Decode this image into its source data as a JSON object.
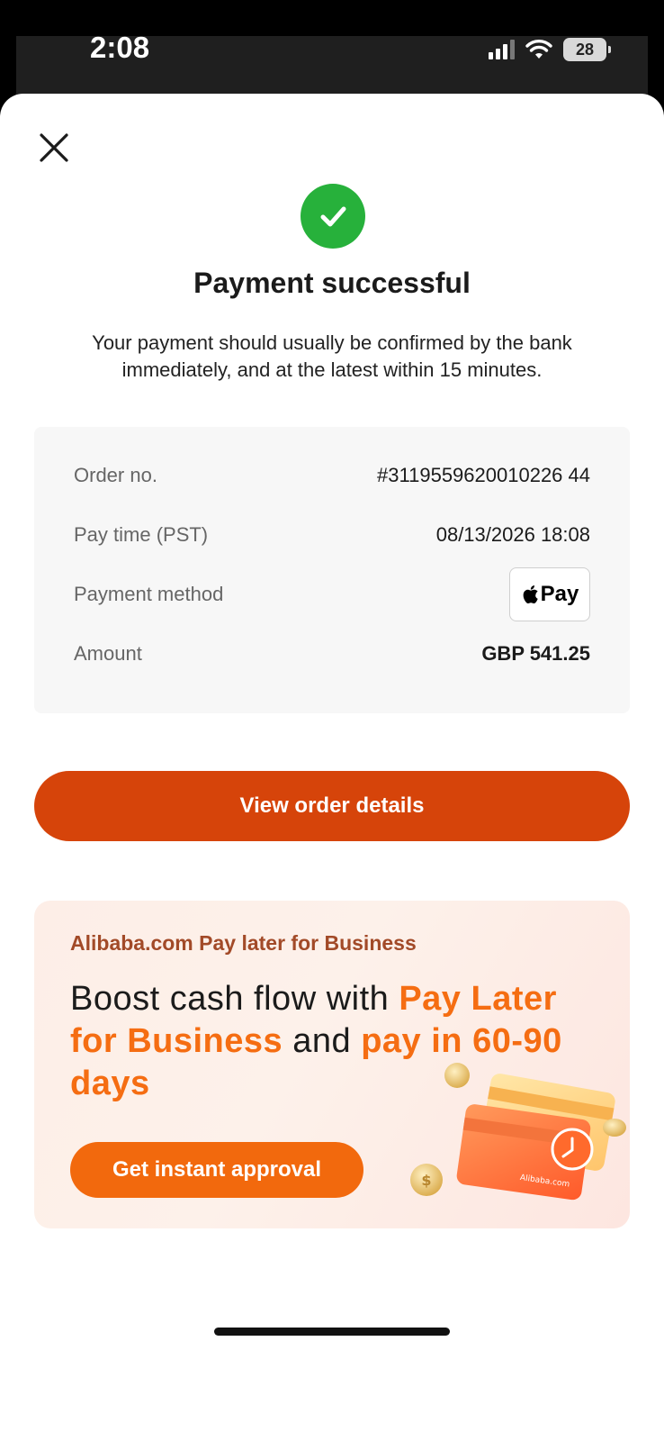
{
  "status_bar": {
    "time": "2:08",
    "battery": "28"
  },
  "sheet": {
    "title": "Payment successful",
    "subtitle": "Your payment should usually be confirmed by the bank immediately, and at the latest within 15 minutes.",
    "details": [
      {
        "label": "Order no.",
        "value": "#3119559620010226 44"
      },
      {
        "label": "Pay time (PST)",
        "value": "08/13/2026 18:08"
      },
      {
        "label": "Payment method",
        "value": "Pay"
      },
      {
        "label": "Amount",
        "value": "GBP 541.25"
      }
    ],
    "view_order_button": "View order details"
  },
  "promo": {
    "brand": "Alibaba.com Pay later for Business",
    "headline_start": "Boost cash flow with ",
    "headline_highlight_1": "Pay Later for Business",
    "headline_mid": " and ",
    "headline_highlight_2": "pay in 60-90 days",
    "button": "Get instant approval",
    "card_brand": "Alibaba.com"
  },
  "colors": {
    "success": "#27b13b",
    "primary": "#d6440a",
    "promo_accent": "#f56d12"
  }
}
